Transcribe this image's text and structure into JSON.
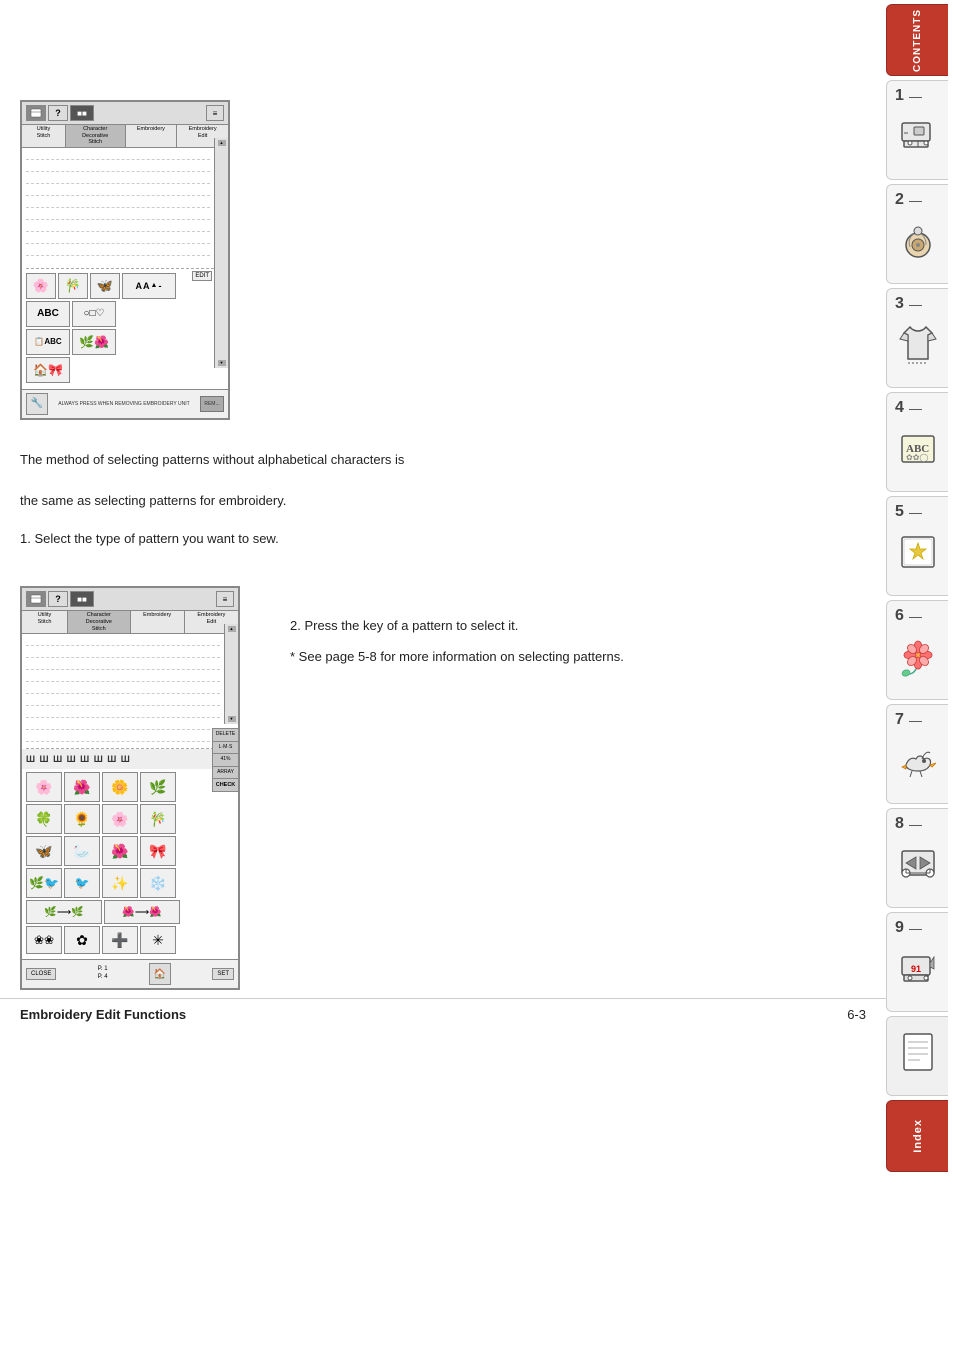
{
  "page": {
    "title": "Embroidery Edit Functions",
    "page_number": "6-3"
  },
  "intro_text_line1": "The method of selecting patterns without alphabetical characters is",
  "intro_text_line2": "the same as selecting patterns for embroidery.",
  "step1": "1.  Select the type of pattern you want to sew.",
  "step2": "2.  Press the key of a pattern to select it.",
  "note": "*   See page 5-8 for more information on selecting patterns.",
  "sidebar": {
    "tabs": [
      {
        "number": "",
        "label": "CONTENTS",
        "type": "contents"
      },
      {
        "number": "1",
        "label": "sewing-machine-icon",
        "dash": "—"
      },
      {
        "number": "2",
        "label": "thread-icon",
        "dash": "—"
      },
      {
        "number": "3",
        "label": "shirt-icon",
        "dash": "—"
      },
      {
        "number": "4",
        "label": "abc-embroidery-icon",
        "dash": "—"
      },
      {
        "number": "5",
        "label": "star-pattern-icon",
        "dash": "—"
      },
      {
        "number": "6",
        "label": "flower-icon",
        "dash": "—"
      },
      {
        "number": "7",
        "label": "bird-icon",
        "dash": "—"
      },
      {
        "number": "8",
        "label": "scissors-icon",
        "dash": "—"
      },
      {
        "number": "9",
        "label": "machine2-icon",
        "dash": "—"
      },
      {
        "number": "",
        "label": "notes-icon",
        "type": "notes"
      },
      {
        "number": "",
        "label": "Index",
        "type": "index"
      }
    ]
  },
  "screen1": {
    "tabs": [
      "Utility\nStitch",
      "Character\nDecorative\nStitch",
      "Embroidery",
      "Embroidery\nEdit"
    ],
    "pattern_rows": [
      [
        "🌸",
        "🐦",
        "🦋",
        "AAA-"
      ],
      [
        "ABC",
        "○□♡",
        ""
      ],
      [
        "📋ABC",
        "🌿🌺",
        ""
      ],
      [
        "",
        "🏠🎀",
        ""
      ]
    ],
    "bottom_label": "ALWAYS PRESS WHEN REMOVING EMBROIDERY UNIT",
    "edit_label": "EDIT"
  },
  "screen2": {
    "tabs": [
      "Utility\nStitch",
      "Character\nDecorative\nStitch",
      "Embroidery",
      "Embroidery\nEdit"
    ],
    "segment_symbols": [
      "Ш",
      "Ш",
      "Ш",
      "Ш",
      "Ш",
      "Ш",
      "Ш",
      "Ш"
    ],
    "pattern_rows": [
      [
        "🌸",
        "🌺",
        "🌼",
        "🌿"
      ],
      [
        "🍀",
        "🌻",
        "🌸",
        "🎋"
      ],
      [
        "🦋",
        "🦢",
        "🌺",
        "🎀"
      ],
      [
        "🌿",
        "🐦",
        "✨",
        "🎋"
      ]
    ],
    "side_buttons": [
      "DELETE",
      "L·M·S",
      "41%",
      "ARRAY",
      "CHECK"
    ],
    "bottom_items": [
      "CLOSE",
      "P. 1\nP. 4",
      "🏠",
      "SET"
    ]
  }
}
